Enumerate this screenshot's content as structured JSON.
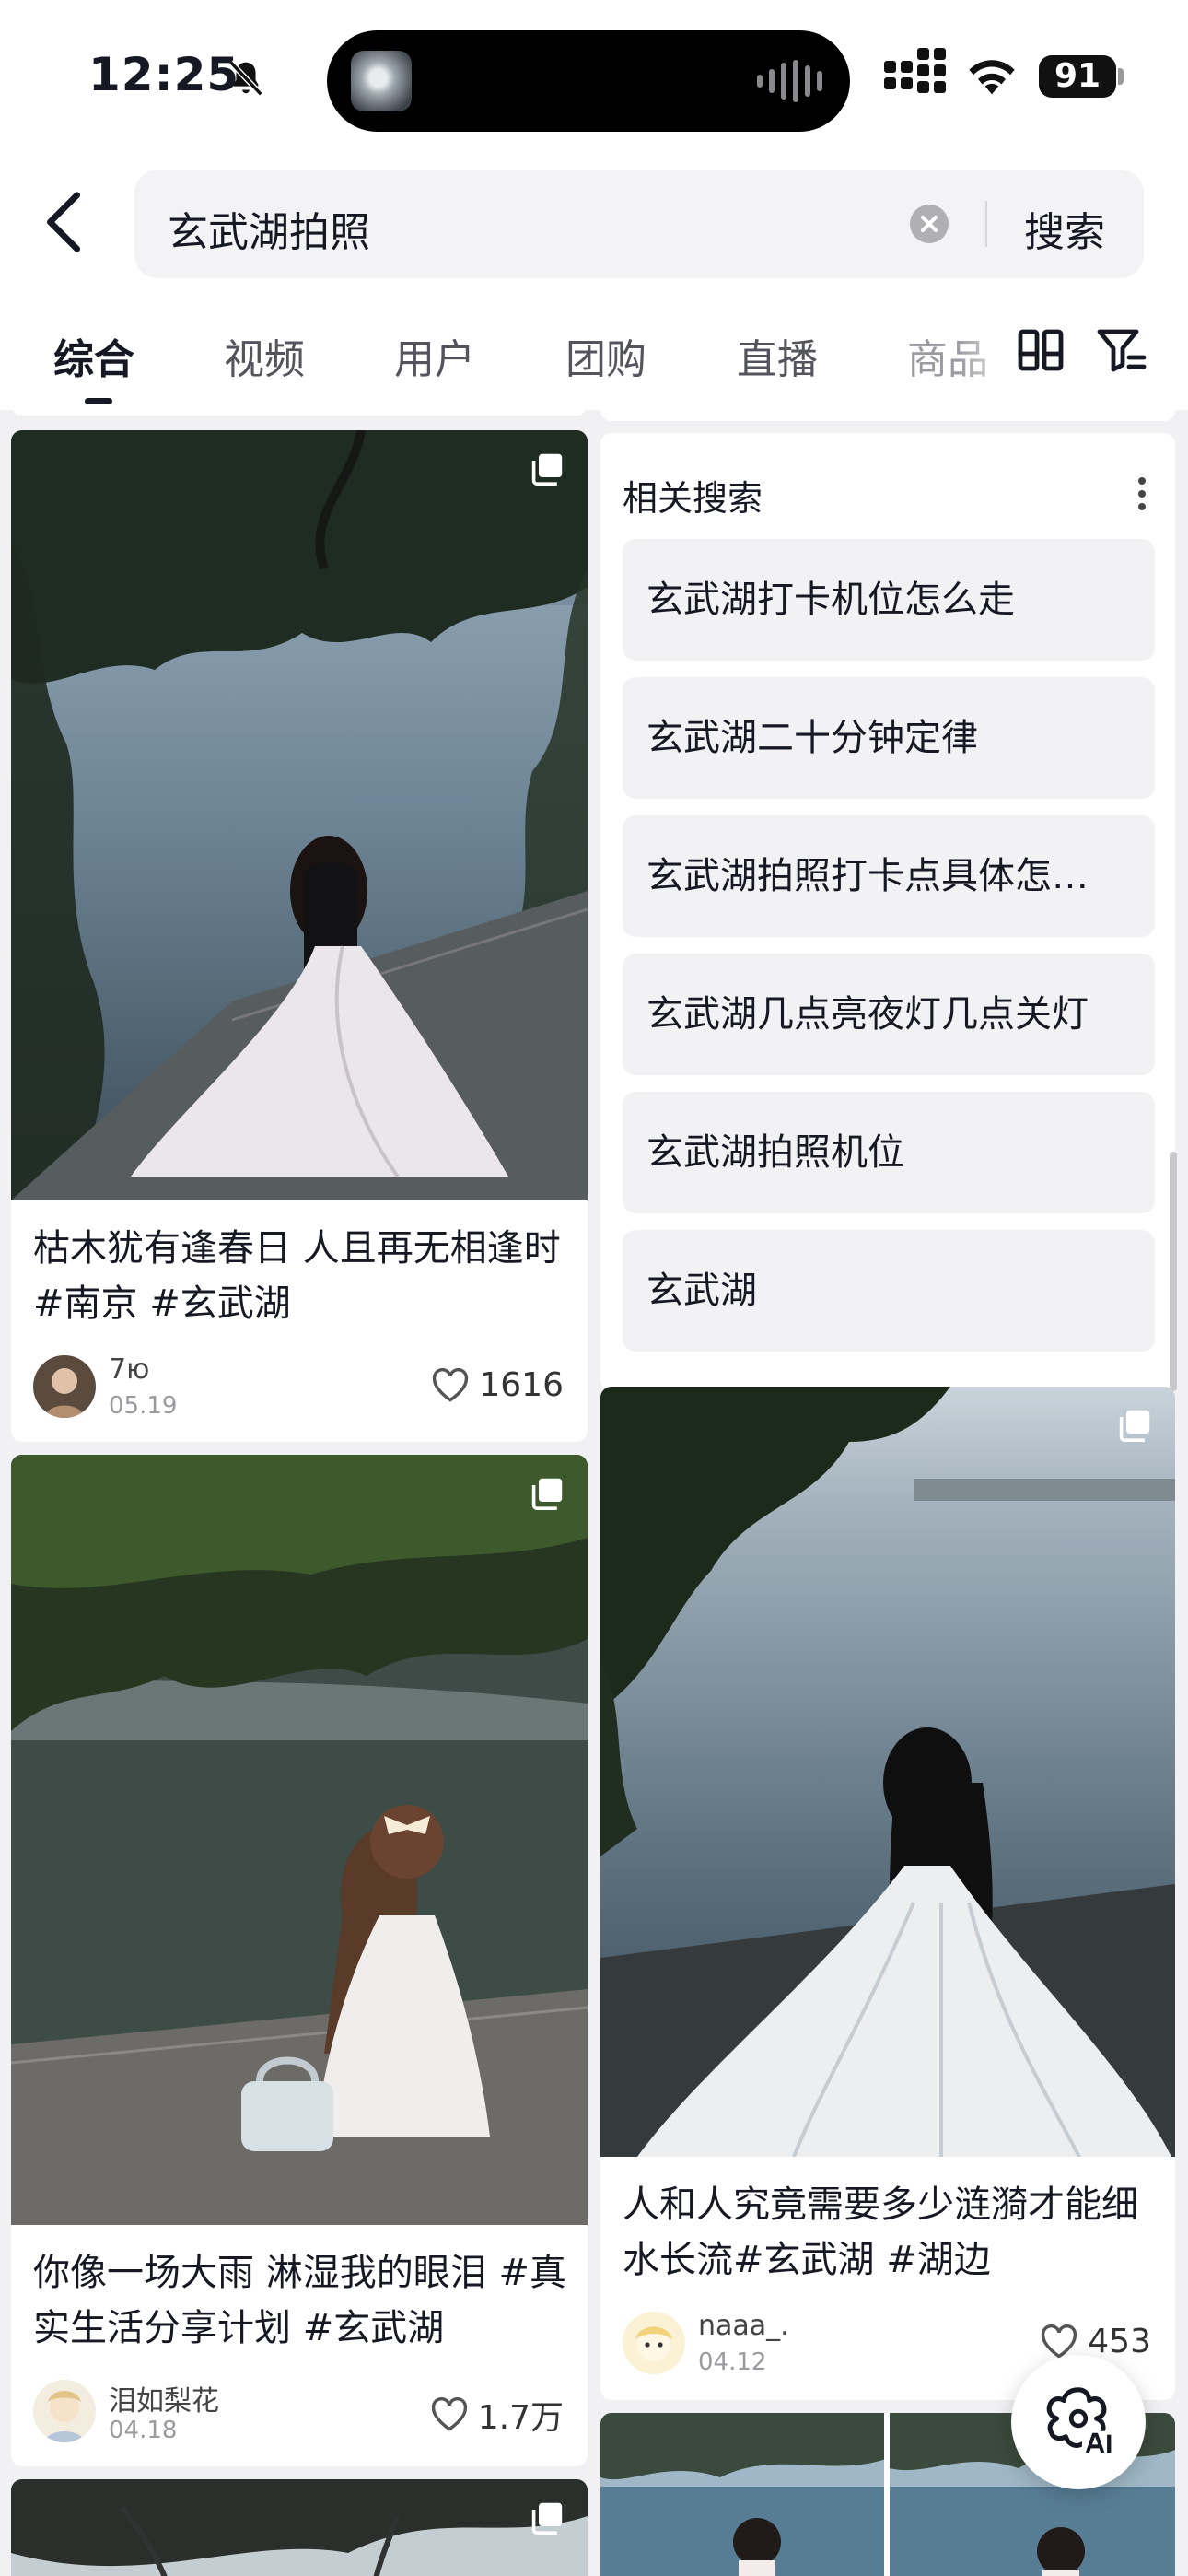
{
  "status_bar": {
    "time": "12:25",
    "battery": "91"
  },
  "search": {
    "query": "玄武湖拍照",
    "submit_label": "搜索"
  },
  "tabs": [
    {
      "label": "综合",
      "active": true
    },
    {
      "label": "视频",
      "active": false
    },
    {
      "label": "用户",
      "active": false
    },
    {
      "label": "团购",
      "active": false
    },
    {
      "label": "直播",
      "active": false
    },
    {
      "label": "商品",
      "active": false
    }
  ],
  "related_search": {
    "title": "相关搜索",
    "items": [
      "玄武湖打卡机位怎么走",
      "玄武湖二十分钟定律",
      "玄武湖拍照打卡点具体怎…",
      "玄武湖几点亮夜灯几点关灯",
      "玄武湖拍照机位",
      "玄武湖"
    ]
  },
  "posts": [
    {
      "title": "枯木犹有逢春日 人且再无相逢时#南京 #玄武湖",
      "author": "7ю",
      "date": "05.19",
      "likes": "1616"
    },
    {
      "title": "你像一场大雨 淋湿我的眼泪 #真实生活分享计划 #玄武湖",
      "author": "泪如梨花",
      "date": "04.18",
      "likes": "1.7万"
    },
    {
      "title": "人和人究竟需要多少涟漪才能细水长流#玄武湖 #湖边",
      "author": "naaa_.",
      "date": "04.12",
      "likes": "453"
    }
  ],
  "icons": {
    "bell": "bell-slash-icon",
    "back": "chevron-left-icon",
    "clear": "clear-circle-icon",
    "layout": "double-column-icon",
    "filter": "filter-funnel-icon",
    "like": "heart-outline-icon",
    "ai": "ai-assistant-icon"
  }
}
